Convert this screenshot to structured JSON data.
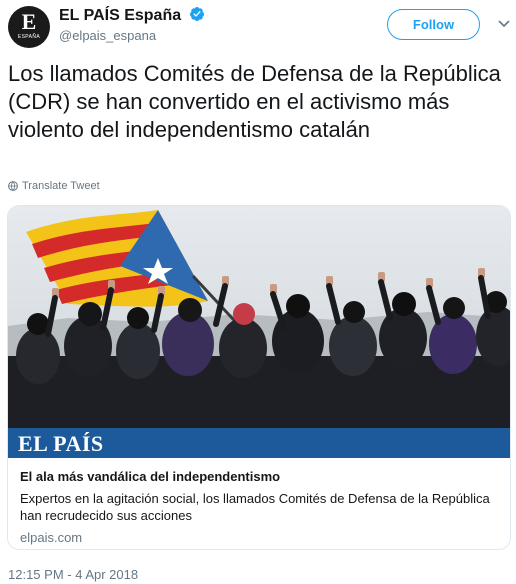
{
  "account": {
    "display_name": "EL PAÍS España",
    "handle": "@elpais_espana",
    "avatar_monogram": "E",
    "avatar_caption": "ESPAÑA",
    "verified": true,
    "verified_color": "#1da1f2"
  },
  "actions": {
    "follow_label": "Follow",
    "accent_color": "#1da1f2"
  },
  "tweet": {
    "text": "Los llamados Comités de Defensa de la República (CDR) se han convertido en el activismo más violento del independentismo catalán",
    "translate_label": "Translate Tweet",
    "timestamp": "12:15 PM - 4 Apr 2018"
  },
  "card": {
    "brand_wordmark": "EL PAÍS",
    "brand_bar_color": "#1c5a9c",
    "title": "El ala más vandálica del independentismo",
    "description": "Expertos en la agitación social, los llamados Comités de Defensa de la República han recrudecido sus acciones",
    "domain": "elpais.com"
  },
  "icons": {
    "verified": "verified-badge-icon",
    "caret": "chevron-down-icon",
    "translate": "globe-icon"
  }
}
